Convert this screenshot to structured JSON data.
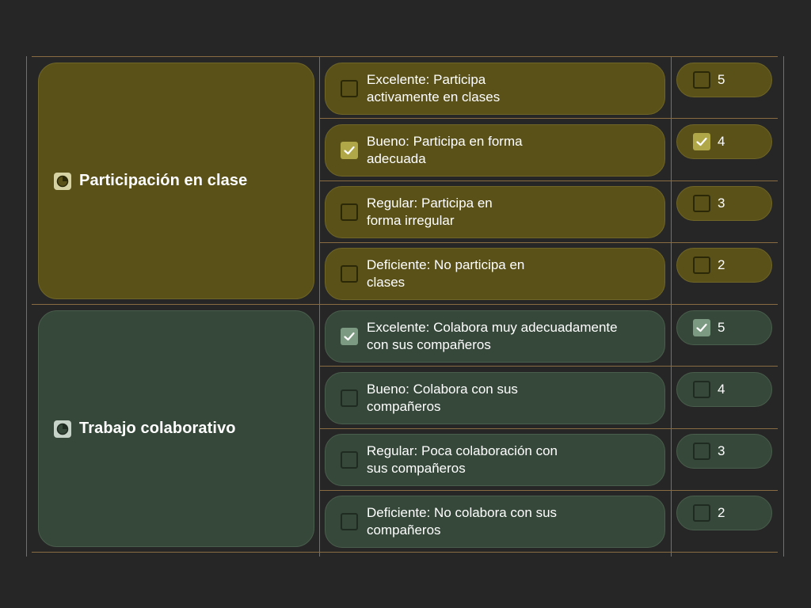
{
  "criteria": [
    {
      "title": "Participación en clase",
      "icon": "pie-chart-icon",
      "levels": [
        {
          "text": "Excelente: Participa activamente en clases",
          "checked": false,
          "score": "5",
          "score_checked": false
        },
        {
          "text": "Bueno: Participa en forma adecuada",
          "checked": true,
          "score": "4",
          "score_checked": true
        },
        {
          "text": "Regular: Participa en forma irregular",
          "checked": false,
          "score": "3",
          "score_checked": false
        },
        {
          "text": "Deficiente: No participa en clases",
          "checked": false,
          "score": "2",
          "score_checked": false
        }
      ]
    },
    {
      "title": "Trabajo colaborativo",
      "icon": "pie-chart-icon",
      "levels": [
        {
          "text": "Excelente: Colabora muy adecuadamente  con sus compañeros",
          "checked": true,
          "score": "5",
          "score_checked": true
        },
        {
          "text": "Bueno: Colabora con sus compañeros",
          "checked": false,
          "score": "4",
          "score_checked": false
        },
        {
          "text": "Regular: Poca colaboración con sus compañeros",
          "checked": false,
          "score": "3",
          "score_checked": false
        },
        {
          "text": "Deficiente: No colabora con sus compañeros",
          "checked": false,
          "score": "2",
          "score_checked": false
        }
      ]
    }
  ],
  "colors": {
    "background": "#262626",
    "grid_line": "#8a6c43",
    "group1_fill": "#5a5119",
    "group1_check": "#b0a848",
    "group2_fill": "#354839",
    "group2_check": "#7c9a82"
  }
}
